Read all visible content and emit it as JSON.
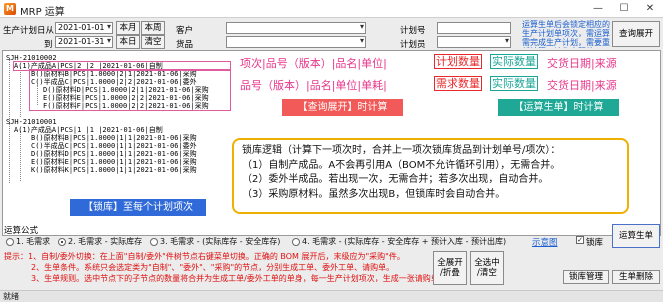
{
  "window": {
    "title": "MRP 运算",
    "minimize": "—",
    "maximize": "☐",
    "close": "✕"
  },
  "filters": {
    "plan_date_from_label": "生产计划日从",
    "plan_date_from": "2021-01-01",
    "plan_date_to_label": "到",
    "plan_date_to": "2021-01-31",
    "btn_this_month": "本月",
    "btn_this_week": "本周",
    "btn_today": "本日",
    "btn_clear": "清空",
    "customer_label": "客户",
    "goods_label": "货品",
    "customer_value": "",
    "goods_value": "",
    "plan_no_label": "计划号",
    "plan_clerk_label": "计划员",
    "plan_no_value": "",
    "plan_clerk_value": "",
    "note": "运算生单后会锁定相应的生产计划单项次，需运算需完成生产计划，需要重新计算，请先去释放。",
    "query_expand_btn": "查询展开"
  },
  "tree": {
    "rows": [
      "SJH-21010002",
      "A(1)产成品A|PCS|2 |2 |2021-01-06|自制",
      "B()原材料B|PCS|1.0000|2|1|2021-01-06|采购",
      "C()半成品C|PCS|1.0000|2|2|2021-01-06|委外",
      "D()原材料D|PCS|1.0000|2|1|2021-01-06|采购",
      "E()原材料E|PCS|1.0000|2|2|2021-01-06|采购",
      "F()原材料F|PCS|1.0000|2|2|2021-01-06|采购",
      "SJH-21010001",
      "A(1)产成品A|PCS|1 |1 |2021-01-06|自制",
      "B()原材料B|PCS|1.0000|1|1|2021-01-06|采购",
      "C()半成品C|PCS|1.0000|1|1|2021-01-06|委外",
      "D()原材料D|PCS|1.0000|1|1|2021-01-06|采购",
      "E()原材料E|PCS|1.0000|1|1|2021-01-06|采购",
      "K()原材料K|PCS|1.0000|1|1|2021-01-06|采购"
    ]
  },
  "annotations": {
    "line1_left": "项次|品号（版本）|品名|单位|",
    "line1_red": "计划数量",
    "line1_teal": "实际数量",
    "line1_right": "交货日期|来源",
    "line2_left": "品号（版本）|品名|单位|单耗|",
    "line2_red": "需求数量",
    "line2_teal": "实际数量",
    "line2_right": "交货日期|来源",
    "tag_query": "【查询展开】时计算",
    "tag_run": "【运算生单】时计算",
    "tag_lock": "【锁库】至每个计划项次",
    "callout_lines": [
      "锁库逻辑（计算下一项次时，合并上一项次锁库货品到计划单号/项次）：",
      "（1）自制产成品。A不会再引用A（BOM不允许循环引用），无需合并。",
      "（2）委外半成品。若出现一次，无需合并；若多次出现，自动合并。",
      "（3）采购原材料。虽然多次出现B，但锁库时会自动合并。"
    ]
  },
  "bottom": {
    "algorithm_label": "运算公式",
    "options": [
      "1. 毛需求",
      "2. 毛需求 - 实际库存",
      "3. 毛需求 - (实际库存 - 安全库存)",
      "4. 毛需求 - (实际库存 - 安全库存 + 预计入库 - 预计出库)"
    ],
    "selected_option": 1,
    "example_link": "示意图",
    "lock_label": "锁库",
    "lock_checked": true,
    "run_btn": "运算生单",
    "expand_all_btn": "全展开\n/折叠",
    "select_all_btn": "全选中\n/清空",
    "lock_manage_btn": "锁库管理",
    "delete_btn": "生单删除",
    "hints": [
      "提示：1、自制/委外切换：在上面\"自制/委外\"件树节点右键菜单切换。正确的 BOM 展开后，末级应为\"采购\"件。",
      "2、生单条件。系统只会选定类为\"自制\"、\"委外\"、\"采购\"的节点，分别生成工单、委外工单、请购单。",
      "3、生单规则。选中节点下的子节点的数量将合并为生成工单/委外工单的单身，每一生产计划项次，生成一张请购单。"
    ]
  },
  "status_bar": {
    "text": "就绪"
  },
  "colors": {
    "pink": "#e8358a",
    "red": "#e8282a",
    "teal": "#1aa596",
    "tag_red": "#f25a5a",
    "tag_teal": "#1fa896",
    "tag_blue": "#2f6ad8",
    "callout_border": "#f0b000"
  }
}
